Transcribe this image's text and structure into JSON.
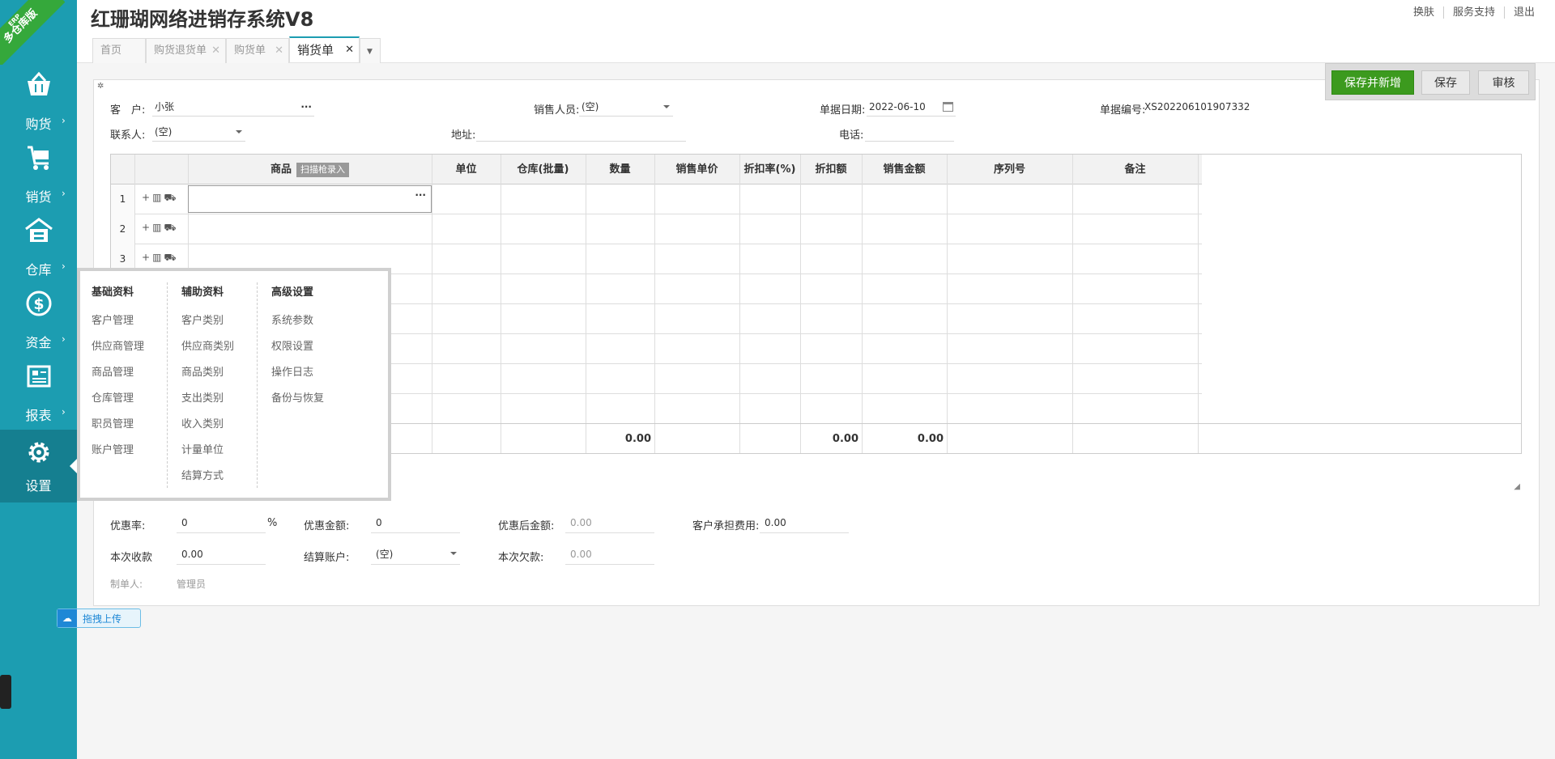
{
  "app": {
    "title": "红珊瑚网络进销存系统V8",
    "ribbon_line1": "ERP",
    "ribbon_line2": "多仓库版"
  },
  "top_links": [
    "换肤",
    "服务支持",
    "退出"
  ],
  "nav": [
    {
      "label": "购货",
      "icon": "basket-icon"
    },
    {
      "label": "销货",
      "icon": "cart-icon"
    },
    {
      "label": "仓库",
      "icon": "warehouse-icon"
    },
    {
      "label": "资金",
      "icon": "dollar-icon"
    },
    {
      "label": "报表",
      "icon": "report-icon"
    },
    {
      "label": "设置",
      "icon": "gear-icon"
    }
  ],
  "tabs": [
    {
      "label": "首页"
    },
    {
      "label": "购货退货单"
    },
    {
      "label": "购货单"
    },
    {
      "label": "销货单"
    }
  ],
  "toolbar": {
    "save_new": "保存并新增",
    "save": "保存",
    "audit": "审核"
  },
  "form": {
    "customer_label": "客　户:",
    "customer_value": "小张",
    "salesperson_label": "销售人员:",
    "salesperson_value": "(空)",
    "date_label": "单据日期:",
    "date_value": "2022-06-10",
    "docno_label": "单据编号:",
    "docno_value": "XS202206101907332",
    "contact_label": "联系人:",
    "contact_value": "(空)",
    "address_label": "地址:",
    "phone_label": "电话:"
  },
  "grid": {
    "columns": [
      "商品",
      "单位",
      "仓库(批量)",
      "数量",
      "销售单价",
      "折扣率(%)",
      "折扣额",
      "销售金额",
      "序列号",
      "备注"
    ],
    "scan_label": "扫描枪录入",
    "row_numbers": [
      "1",
      "2",
      "3"
    ],
    "totals": {
      "qty": "0.00",
      "discount": "0.00",
      "amount": "0.00"
    }
  },
  "footer": {
    "discount_rate_label": "优惠率:",
    "discount_rate_value": "0",
    "pct": "%",
    "discount_amount_label": "优惠金额:",
    "discount_amount_value": "0",
    "after_discount_label": "优惠后金额:",
    "after_discount_value": "0.00",
    "customer_fee_label": "客户承担费用:",
    "customer_fee_value": "0.00",
    "received_label": "本次收款",
    "received_value": "0.00",
    "account_label": "结算账户:",
    "account_value": "(空)",
    "owed_label": "本次欠款:",
    "owed_value": "0.00",
    "maker_label": "制单人:",
    "maker_value": "管理员"
  },
  "flyout": {
    "col1": {
      "title": "基础资料",
      "items": [
        "客户管理",
        "供应商管理",
        "商品管理",
        "仓库管理",
        "职员管理",
        "账户管理"
      ]
    },
    "col2": {
      "title": "辅助资料",
      "items": [
        "客户类别",
        "供应商类别",
        "商品类别",
        "支出类别",
        "收入类别",
        "计量单位",
        "结算方式"
      ]
    },
    "col3": {
      "title": "高级设置",
      "items": [
        "系统参数",
        "权限设置",
        "操作日志",
        "备份与恢复"
      ]
    }
  },
  "upload": {
    "label": "拖拽上传"
  },
  "colors": {
    "sidebar": "#1c9db1",
    "primary_button": "#3c9a1e",
    "ribbon": "#35a83b"
  }
}
